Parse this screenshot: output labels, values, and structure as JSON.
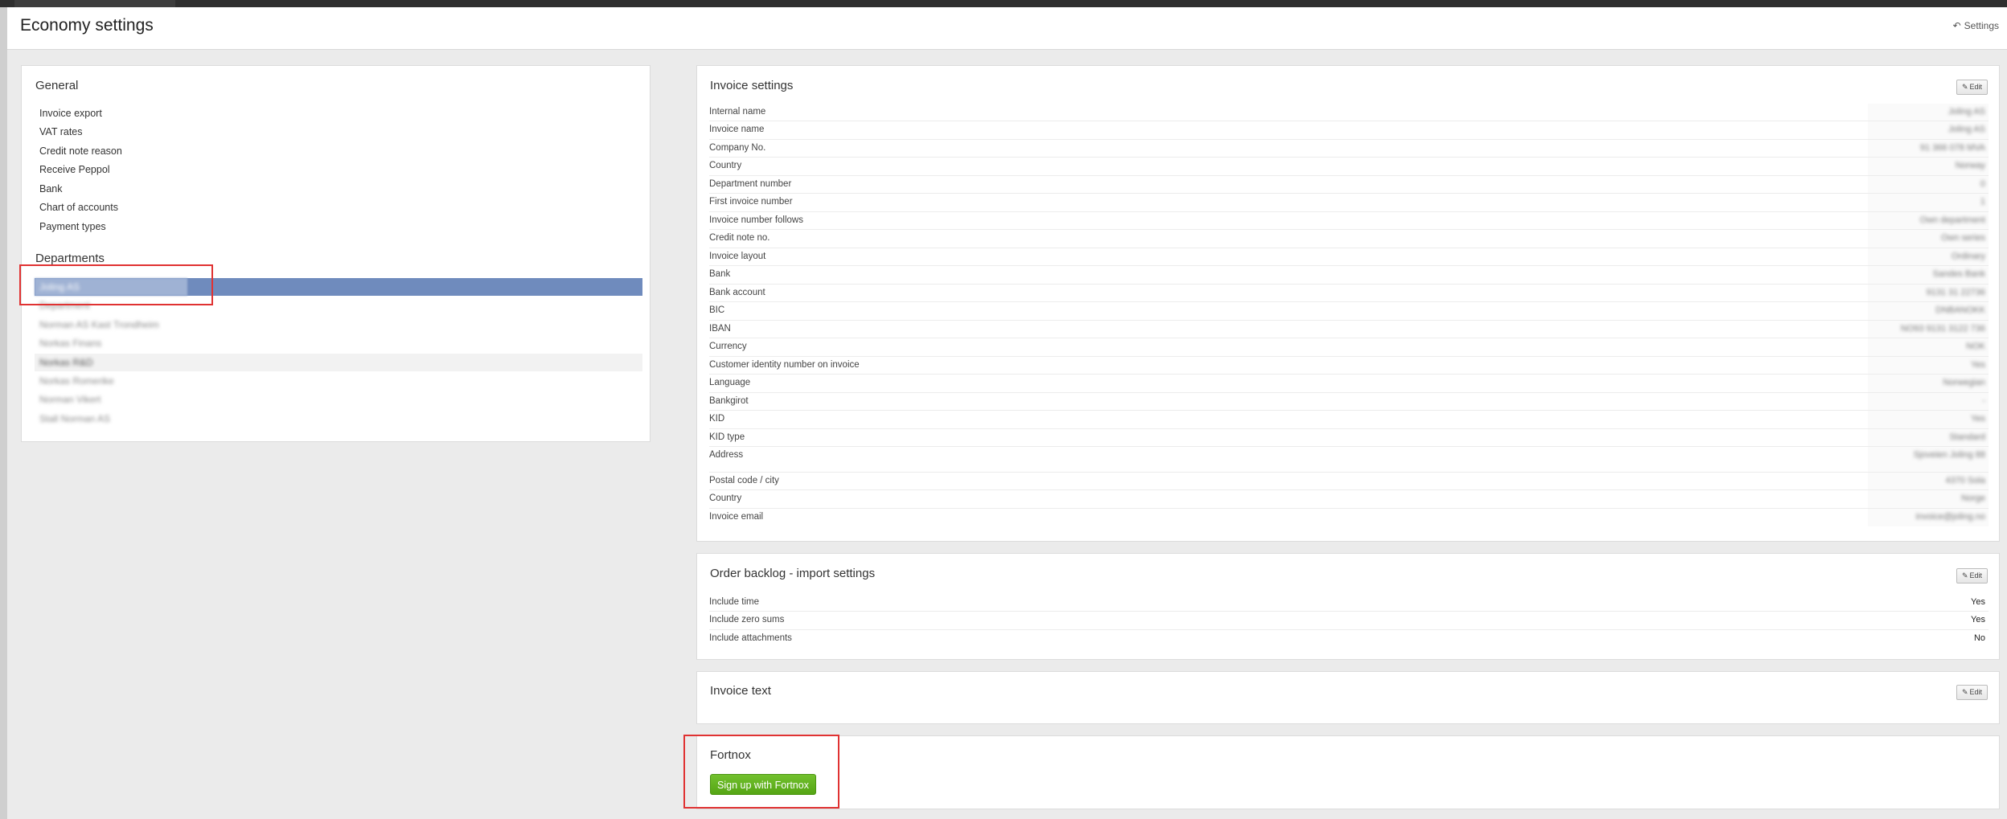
{
  "header": {
    "title": "Economy settings",
    "back_label": "Settings",
    "back_icon": "↶"
  },
  "general": {
    "title": "General",
    "items": [
      "Invoice export",
      "VAT rates",
      "Credit note reason",
      "Receive Peppol",
      "Bank",
      "Chart of accounts",
      "Payment types"
    ]
  },
  "departments": {
    "title": "Departments",
    "items": [
      "Joling AS",
      "Department",
      "Norman AS Kast Trondheim",
      "Norkas Finans",
      "Norkas R&D",
      "Norkas Romerike",
      "Norman Vikert",
      "Stall Norman AS"
    ]
  },
  "invoice_settings": {
    "title": "Invoice settings",
    "edit_label": "Edit",
    "rows": [
      {
        "label": "Internal name",
        "value": "Joling AS"
      },
      {
        "label": "Invoice name",
        "value": "Joling AS"
      },
      {
        "label": "Company No.",
        "value": "91 366 078 MVA"
      },
      {
        "label": "Country",
        "value": "Norway"
      },
      {
        "label": "Department number",
        "value": "0"
      },
      {
        "label": "First invoice number",
        "value": "1"
      },
      {
        "label": "Invoice number follows",
        "value": "Own department"
      },
      {
        "label": "Credit note no.",
        "value": "Own series"
      },
      {
        "label": "Invoice layout",
        "value": "Ordinary"
      },
      {
        "label": "Bank",
        "value": "Sandes Bank"
      },
      {
        "label": "Bank account",
        "value": "9131 31 22736"
      },
      {
        "label": "BIC",
        "value": "DNBANOKK"
      },
      {
        "label": "IBAN",
        "value": "NO93 9131 3122 736"
      },
      {
        "label": "Currency",
        "value": "NOK"
      },
      {
        "label": "Customer identity number on invoice",
        "value": "Yes"
      },
      {
        "label": "Language",
        "value": "Norwegian"
      },
      {
        "label": "Bankgirot",
        "value": "-"
      },
      {
        "label": "KID",
        "value": "Yes"
      },
      {
        "label": "KID type",
        "value": "Standard"
      },
      {
        "label": "Address",
        "value": "Sjoveien Joling 88"
      },
      {
        "label": "Postal code / city",
        "value": "4370 Sola"
      },
      {
        "label": "Country",
        "value": "Norge"
      },
      {
        "label": "Invoice email",
        "value": "invoice@joling.no"
      }
    ]
  },
  "order_backlog": {
    "title": "Order backlog - import settings",
    "edit_label": "Edit",
    "rows": [
      {
        "label": "Include time",
        "value": "Yes"
      },
      {
        "label": "Include zero sums",
        "value": "Yes"
      },
      {
        "label": "Include attachments",
        "value": "No"
      }
    ]
  },
  "invoice_text": {
    "title": "Invoice text",
    "edit_label": "Edit"
  },
  "fortnox": {
    "title": "Fortnox",
    "button_label": "Sign up with Fortnox",
    "button_color": "#5fb31d"
  },
  "colors": {
    "selected_department": "#6f8bbd",
    "highlight_border": "#e03232"
  }
}
